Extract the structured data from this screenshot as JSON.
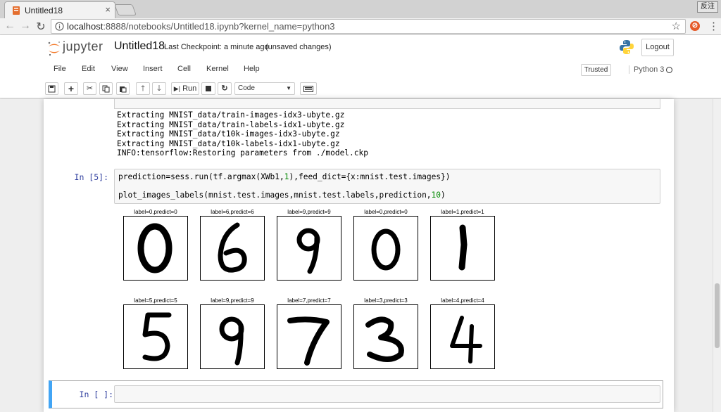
{
  "browser": {
    "tab_title": "Untitled18",
    "close_glyph": "×",
    "sys_button": "反注",
    "url_host": "localhost",
    "url_path": ":8888/notebooks/Untitled18.ipynb?kernel_name=python3"
  },
  "header": {
    "logo_text": "jupyter",
    "notebook_name": "Untitled18",
    "checkpoint": "Last Checkpoint: a minute ago",
    "save_status": "(unsaved changes)",
    "logout": "Logout"
  },
  "menu": [
    "File",
    "Edit",
    "View",
    "Insert",
    "Cell",
    "Kernel",
    "Help"
  ],
  "trusted": "Trusted",
  "kernel": "Python 3",
  "toolbar": {
    "run_label": "Run",
    "cell_type": "Code"
  },
  "output_lines": [
    "Extracting MNIST_data/train-images-idx3-ubyte.gz",
    "Extracting MNIST_data/train-labels-idx1-ubyte.gz",
    "Extracting MNIST_data/t10k-images-idx3-ubyte.gz",
    "Extracting MNIST_data/t10k-labels-idx1-ubyte.gz",
    "INFO:tensorflow:Restoring parameters from ./model.ckp"
  ],
  "cell5": {
    "prompt": "In [5]:",
    "line1_a": "prediction=sess.run(tf.argmax(XWb1,",
    "line1_num": "1",
    "line1_b": "),feed_dict={x:mnist.test.images})",
    "line2_a": "plot_images_labels(mnist.test.images,mnist.test.labels,prediction,",
    "line2_num": "10",
    "line2_b": ")"
  },
  "digits": [
    {
      "label": "label=0,predict=0",
      "digit": "0"
    },
    {
      "label": "label=6,predict=6",
      "digit": "6"
    },
    {
      "label": "label=9,predict=9",
      "digit": "9"
    },
    {
      "label": "label=0,predict=0",
      "digit": "0"
    },
    {
      "label": "label=1,predict=1",
      "digit": "1"
    },
    {
      "label": "label=5,predict=5",
      "digit": "5"
    },
    {
      "label": "label=9,predict=9",
      "digit": "9"
    },
    {
      "label": "label=7,predict=7",
      "digit": "7"
    },
    {
      "label": "label=3,predict=3",
      "digit": "3"
    },
    {
      "label": "label=4,predict=4",
      "digit": "4"
    }
  ],
  "empty_cell_prompt": "In [ ]:",
  "colors": {
    "prompt": "#303f9f",
    "selected_border": "#42a5f5",
    "number": "#008800"
  }
}
